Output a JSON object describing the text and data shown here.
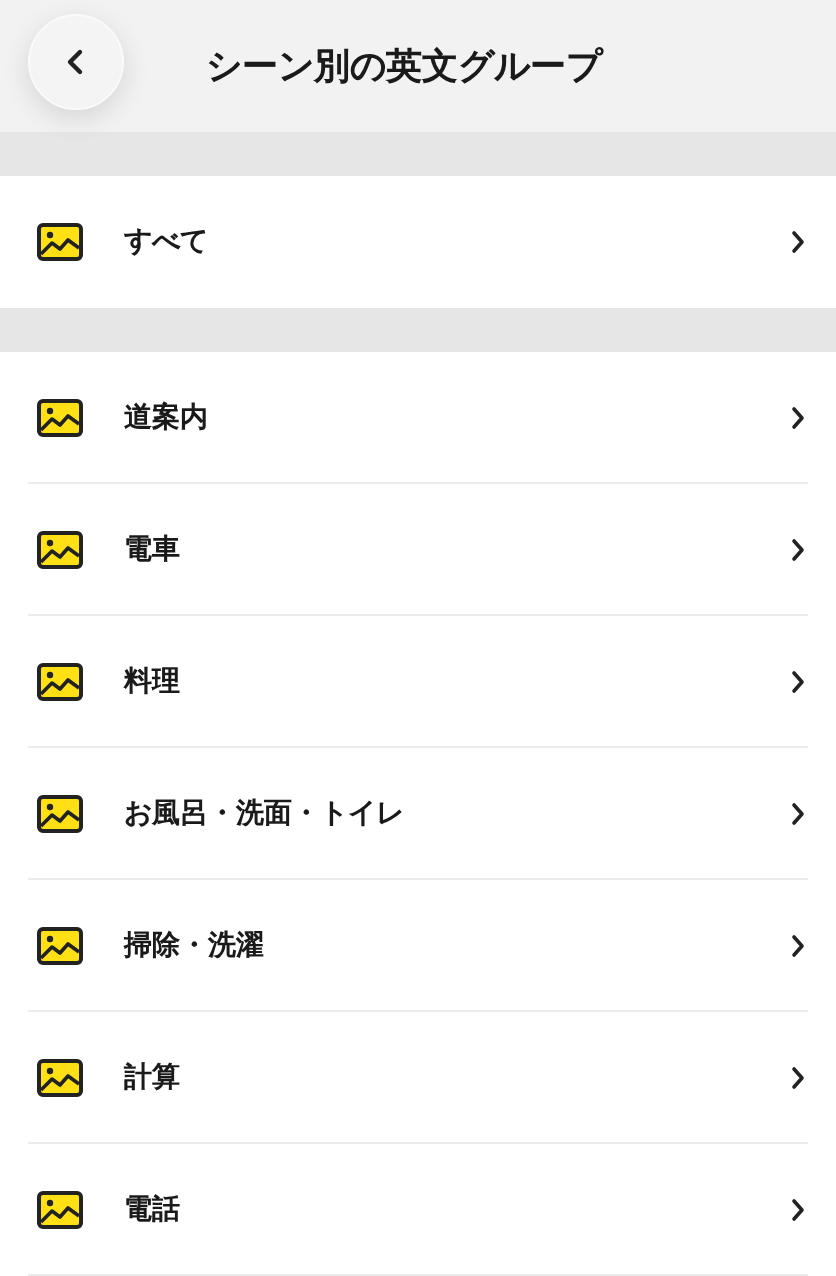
{
  "header": {
    "title": "シーン別の英文グループ"
  },
  "sections": [
    {
      "items": [
        {
          "label": "すべて"
        }
      ]
    },
    {
      "items": [
        {
          "label": "道案内"
        },
        {
          "label": "電車"
        },
        {
          "label": "料理"
        },
        {
          "label": "お風呂・洗面・トイレ"
        },
        {
          "label": "掃除・洗濯"
        },
        {
          "label": "計算"
        },
        {
          "label": "電話"
        }
      ]
    }
  ]
}
